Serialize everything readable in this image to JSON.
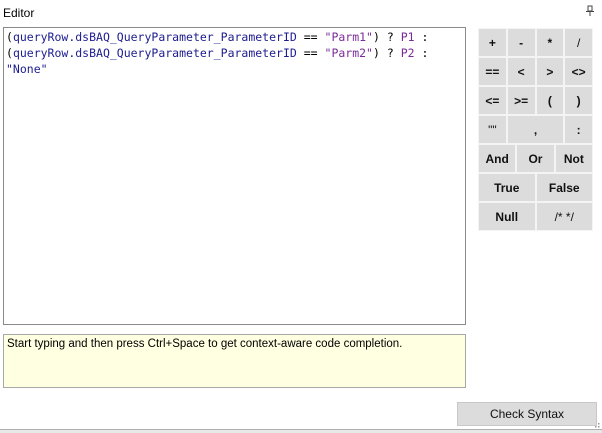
{
  "window": {
    "title": "Editor",
    "pin_icon": "pin-icon"
  },
  "editor": {
    "lines": [
      [
        {
          "text": "(",
          "cls": ""
        },
        {
          "text": "queryRow.dsBAQ_QueryParameter_ParameterID",
          "cls": "c-id"
        },
        {
          "text": " == ",
          "cls": ""
        },
        {
          "text": "\"Parm1\"",
          "cls": "c-str"
        },
        {
          "text": ") ? ",
          "cls": ""
        },
        {
          "text": "P1",
          "cls": "c-p"
        },
        {
          "text": " :",
          "cls": ""
        }
      ],
      [
        {
          "text": "(",
          "cls": ""
        },
        {
          "text": "queryRow.dsBAQ_QueryParameter_ParameterID",
          "cls": "c-id"
        },
        {
          "text": " == ",
          "cls": ""
        },
        {
          "text": "\"Parm2\"",
          "cls": "c-str"
        },
        {
          "text": ") ? ",
          "cls": ""
        },
        {
          "text": "P2",
          "cls": "c-p"
        },
        {
          "text": " :",
          "cls": ""
        }
      ],
      [
        {
          "text": "\"None\"",
          "cls": "c-id"
        }
      ]
    ]
  },
  "hint": {
    "text": "Start typing and then press Ctrl+Space to get context-aware code completion."
  },
  "keypad": {
    "rows": [
      [
        "+",
        "-",
        "*",
        "/"
      ],
      [
        "==",
        "<",
        ">",
        "<>"
      ],
      [
        "<=",
        ">=",
        "(",
        ")"
      ],
      [
        "\"\"",
        ",",
        ":"
      ],
      [
        "And",
        "Or",
        "Not"
      ],
      [
        "True",
        "False"
      ],
      [
        "Null",
        "/* */"
      ]
    ]
  },
  "buttons": {
    "check_syntax": "Check Syntax"
  }
}
